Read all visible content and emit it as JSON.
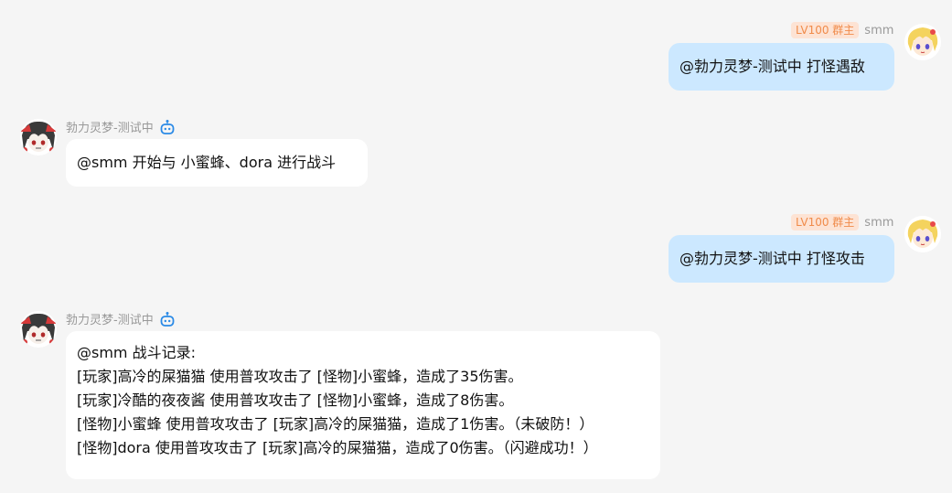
{
  "self": {
    "name": "smm",
    "badge": "LV100 群主"
  },
  "bot": {
    "name": "勃力灵梦-测试中"
  },
  "messages": [
    {
      "sender": "self",
      "text": "@勃力灵梦-测试中 打怪遇敌"
    },
    {
      "sender": "bot",
      "text": "@smm 开始与 小蜜蜂、dora 进行战斗"
    },
    {
      "sender": "self",
      "text": "@勃力灵梦-测试中 打怪攻击"
    },
    {
      "sender": "bot",
      "lines": [
        "@smm 战斗记录:",
        "[玩家]高冷的屎猫猫 使用普攻攻击了 [怪物]小蜜蜂，造成了35伤害。",
        "[玩家]冷酷的夜夜酱 使用普攻攻击了 [怪物]小蜜蜂，造成了8伤害。",
        "[怪物]小蜜蜂 使用普攻攻击了 [玩家]高冷的屎猫猫，造成了1伤害。（未破防！）",
        "[怪物]dora 使用普攻攻击了 [玩家]高冷的屎猫猫，造成了0伤害。（闪避成功！）"
      ]
    }
  ],
  "icons": {
    "bot_status": "robot-icon",
    "self_avatar": "blonde-anime-avatar",
    "bot_avatar": "reimu-anime-avatar"
  },
  "colors": {
    "background": "#f5f5f5",
    "self_bubble": "#cce8ff",
    "bot_bubble": "#ffffff",
    "badge_bg": "#fde3d4",
    "badge_text": "#f08b4a",
    "bot_icon": "#2b8ae6"
  }
}
